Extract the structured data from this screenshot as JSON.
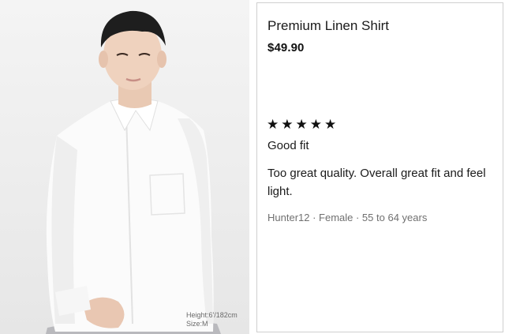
{
  "photo": {
    "caption_height": "Height:6'/182cm",
    "caption_size": "Size:M"
  },
  "product": {
    "name": "Premium Linen Shirt",
    "price": "$49.90"
  },
  "review": {
    "rating": 5,
    "stars": [
      "★",
      "★",
      "★",
      "★",
      "★"
    ],
    "title": "Good fit",
    "body": "Too great quality. Overall great fit and feel light.",
    "reviewer": "Hunter12 · Female · 55 to 64 years"
  },
  "colors": {
    "text": "#1a1a1a",
    "muted": "#707070",
    "card_border": "#cfcfcf",
    "photo_bg": "#ececec"
  }
}
